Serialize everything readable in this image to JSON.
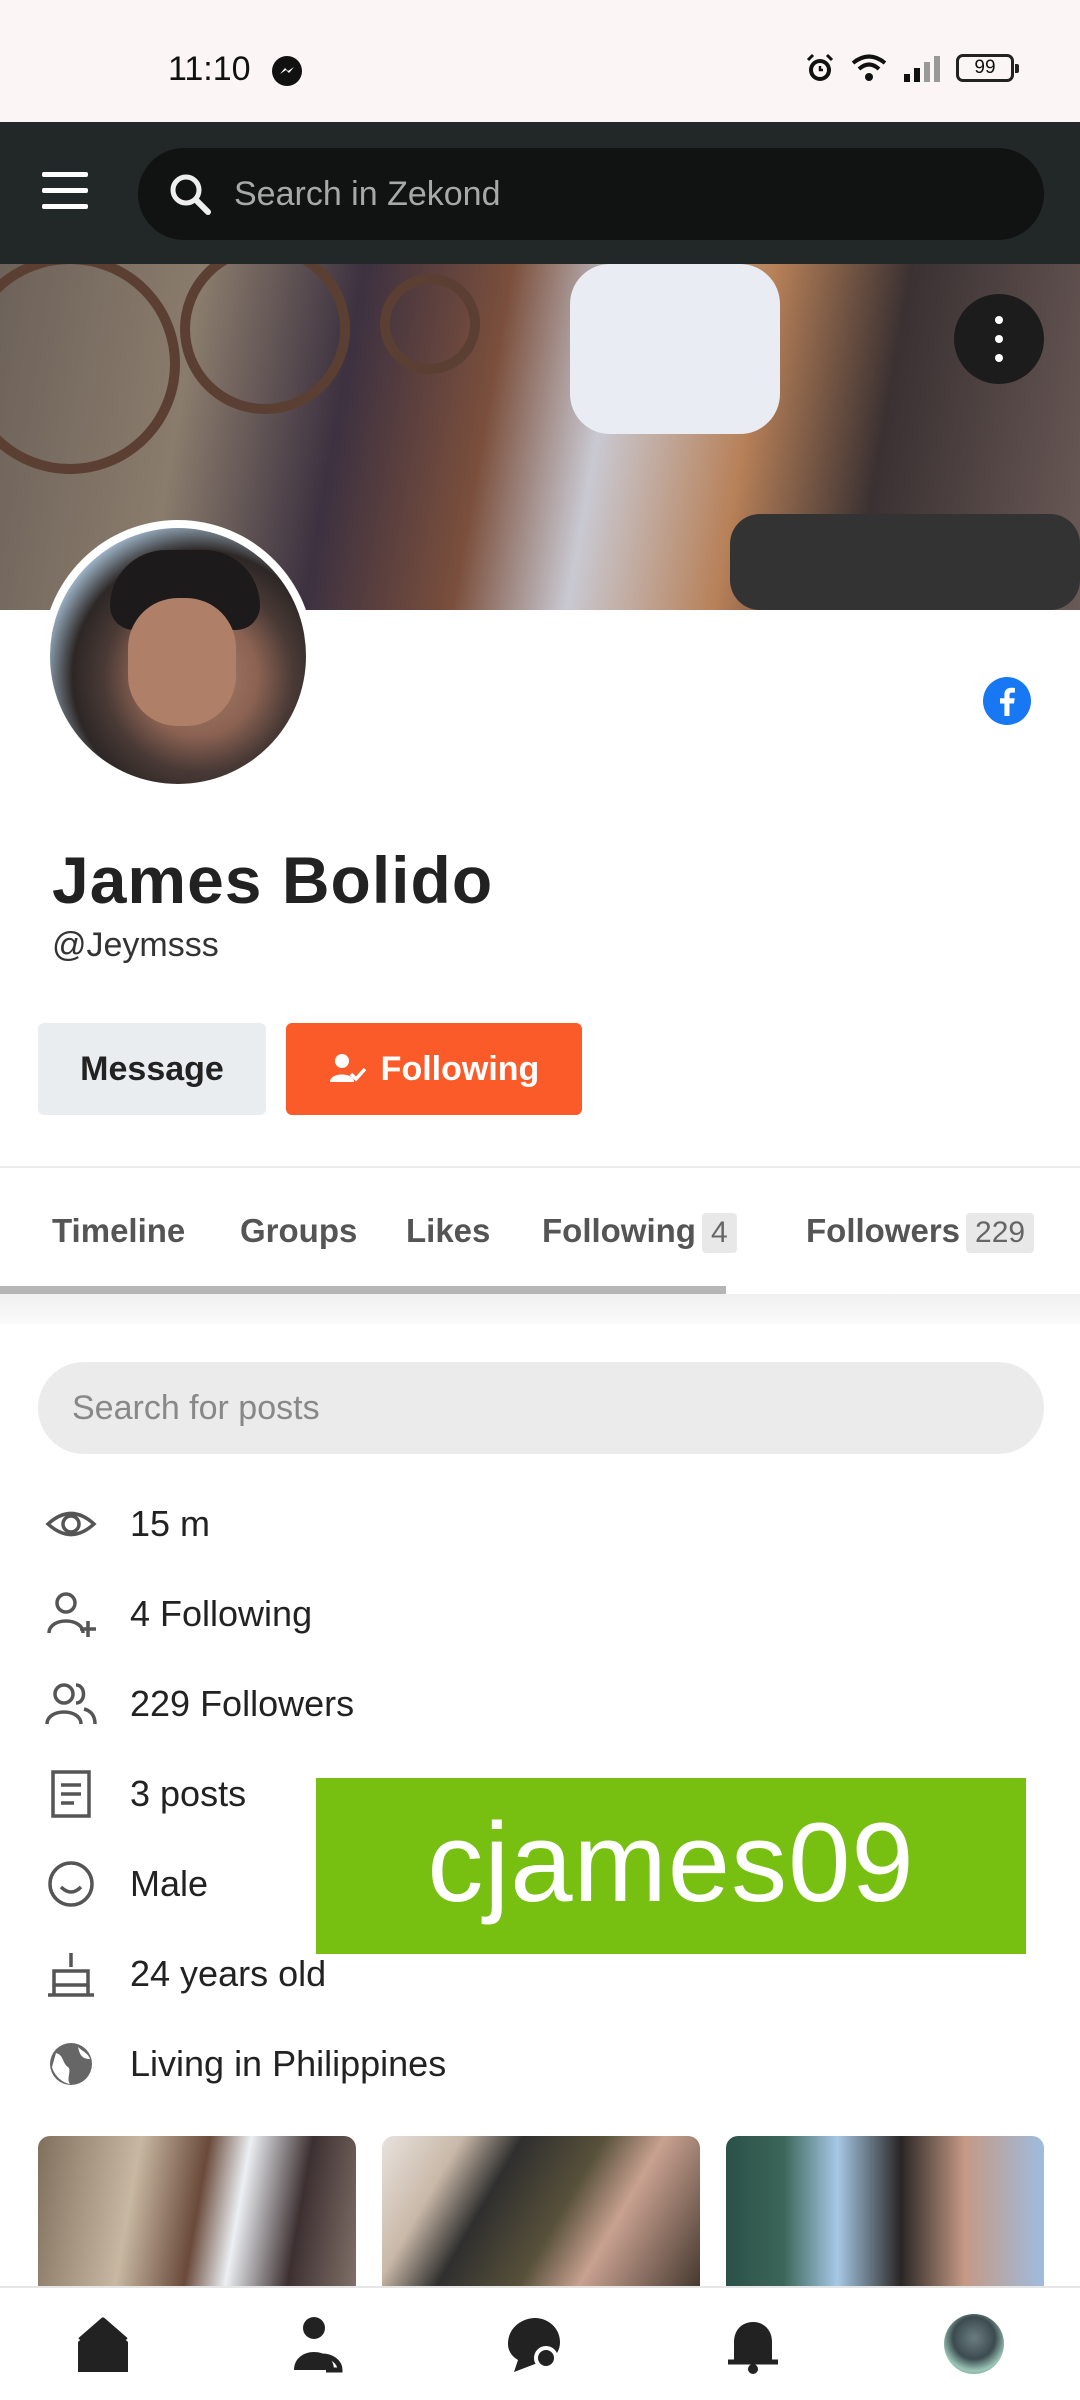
{
  "status_bar": {
    "time": "11:10",
    "battery": "99",
    "icons": [
      "messenger-icon",
      "alarm-icon",
      "wifi-icon",
      "signal-icon",
      "battery-icon"
    ]
  },
  "app_bar": {
    "search_placeholder": "Search in Zekond",
    "icons": [
      "menu-icon",
      "search-icon"
    ]
  },
  "profile": {
    "name": "James Bolido",
    "handle": "@Jeymsss",
    "message_label": "Message",
    "following_label": "Following"
  },
  "tabs": [
    {
      "label": "Timeline"
    },
    {
      "label": "Groups"
    },
    {
      "label": "Likes"
    },
    {
      "label": "Following",
      "count": "4"
    },
    {
      "label": "Followers",
      "count": "229"
    }
  ],
  "posts_search": {
    "placeholder": "Search for posts"
  },
  "info": [
    {
      "icon": "eye-icon",
      "text": "15 m"
    },
    {
      "icon": "user-plus-icon",
      "text": "4 Following"
    },
    {
      "icon": "users-icon",
      "text": "229 Followers"
    },
    {
      "icon": "document-icon",
      "text": "3 posts"
    },
    {
      "icon": "smile-icon",
      "text": "Male"
    },
    {
      "icon": "cake-icon",
      "text": "24 years old"
    },
    {
      "icon": "globe-icon",
      "text": "Living in Philippines"
    }
  ],
  "watermark": "cjames09",
  "colors": {
    "accent": "#fb5a29",
    "appbar": "#222827",
    "facebook": "#1877f2",
    "watermark_bg": "#77c011"
  },
  "bottom_nav": [
    "home-icon",
    "friends-icon",
    "chat-icon",
    "bell-icon",
    "profile-avatar"
  ]
}
